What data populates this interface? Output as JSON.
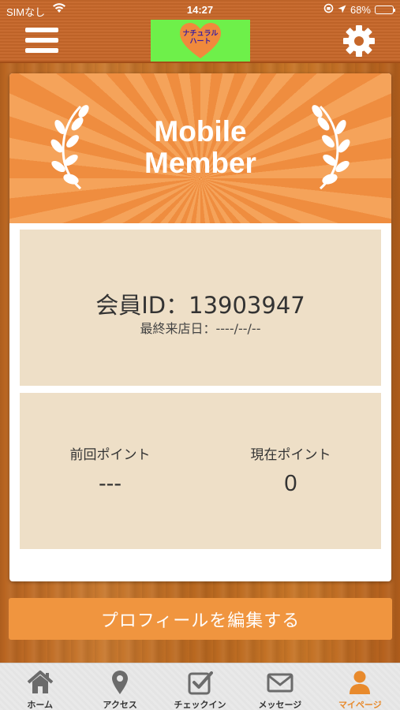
{
  "status_bar": {
    "carrier": "SIMなし",
    "time": "14:27",
    "battery": "68%"
  },
  "header": {
    "logo_text_line1": "ナチュラル",
    "logo_text_line2": "ハート",
    "logo_heart_color": "#f08a3c",
    "logo_bg_color": "#6ef04a"
  },
  "banner": {
    "title_line1": "Mobile",
    "title_line2": "Member"
  },
  "member": {
    "id_text": "会員ID：13903947",
    "last_visit_text": "最終来店日：----/--/--"
  },
  "points": {
    "previous_label": "前回ポイント",
    "previous_value": "---",
    "current_label": "現在ポイント",
    "current_value": "0"
  },
  "edit_profile_label": "プロフィールを編集する",
  "tabs": [
    {
      "label": "ホーム",
      "icon": "home-icon"
    },
    {
      "label": "アクセス",
      "icon": "location-pin-icon"
    },
    {
      "label": "チェックイン",
      "icon": "checkbox-icon"
    },
    {
      "label": "メッセージ",
      "icon": "envelope-icon"
    },
    {
      "label": "マイページ",
      "icon": "person-icon",
      "active": true
    }
  ],
  "colors": {
    "accent": "#f0953f",
    "header_bg": "#c6672a",
    "panel_bg": "#eedfc7",
    "active_tab": "#e88a2c"
  }
}
